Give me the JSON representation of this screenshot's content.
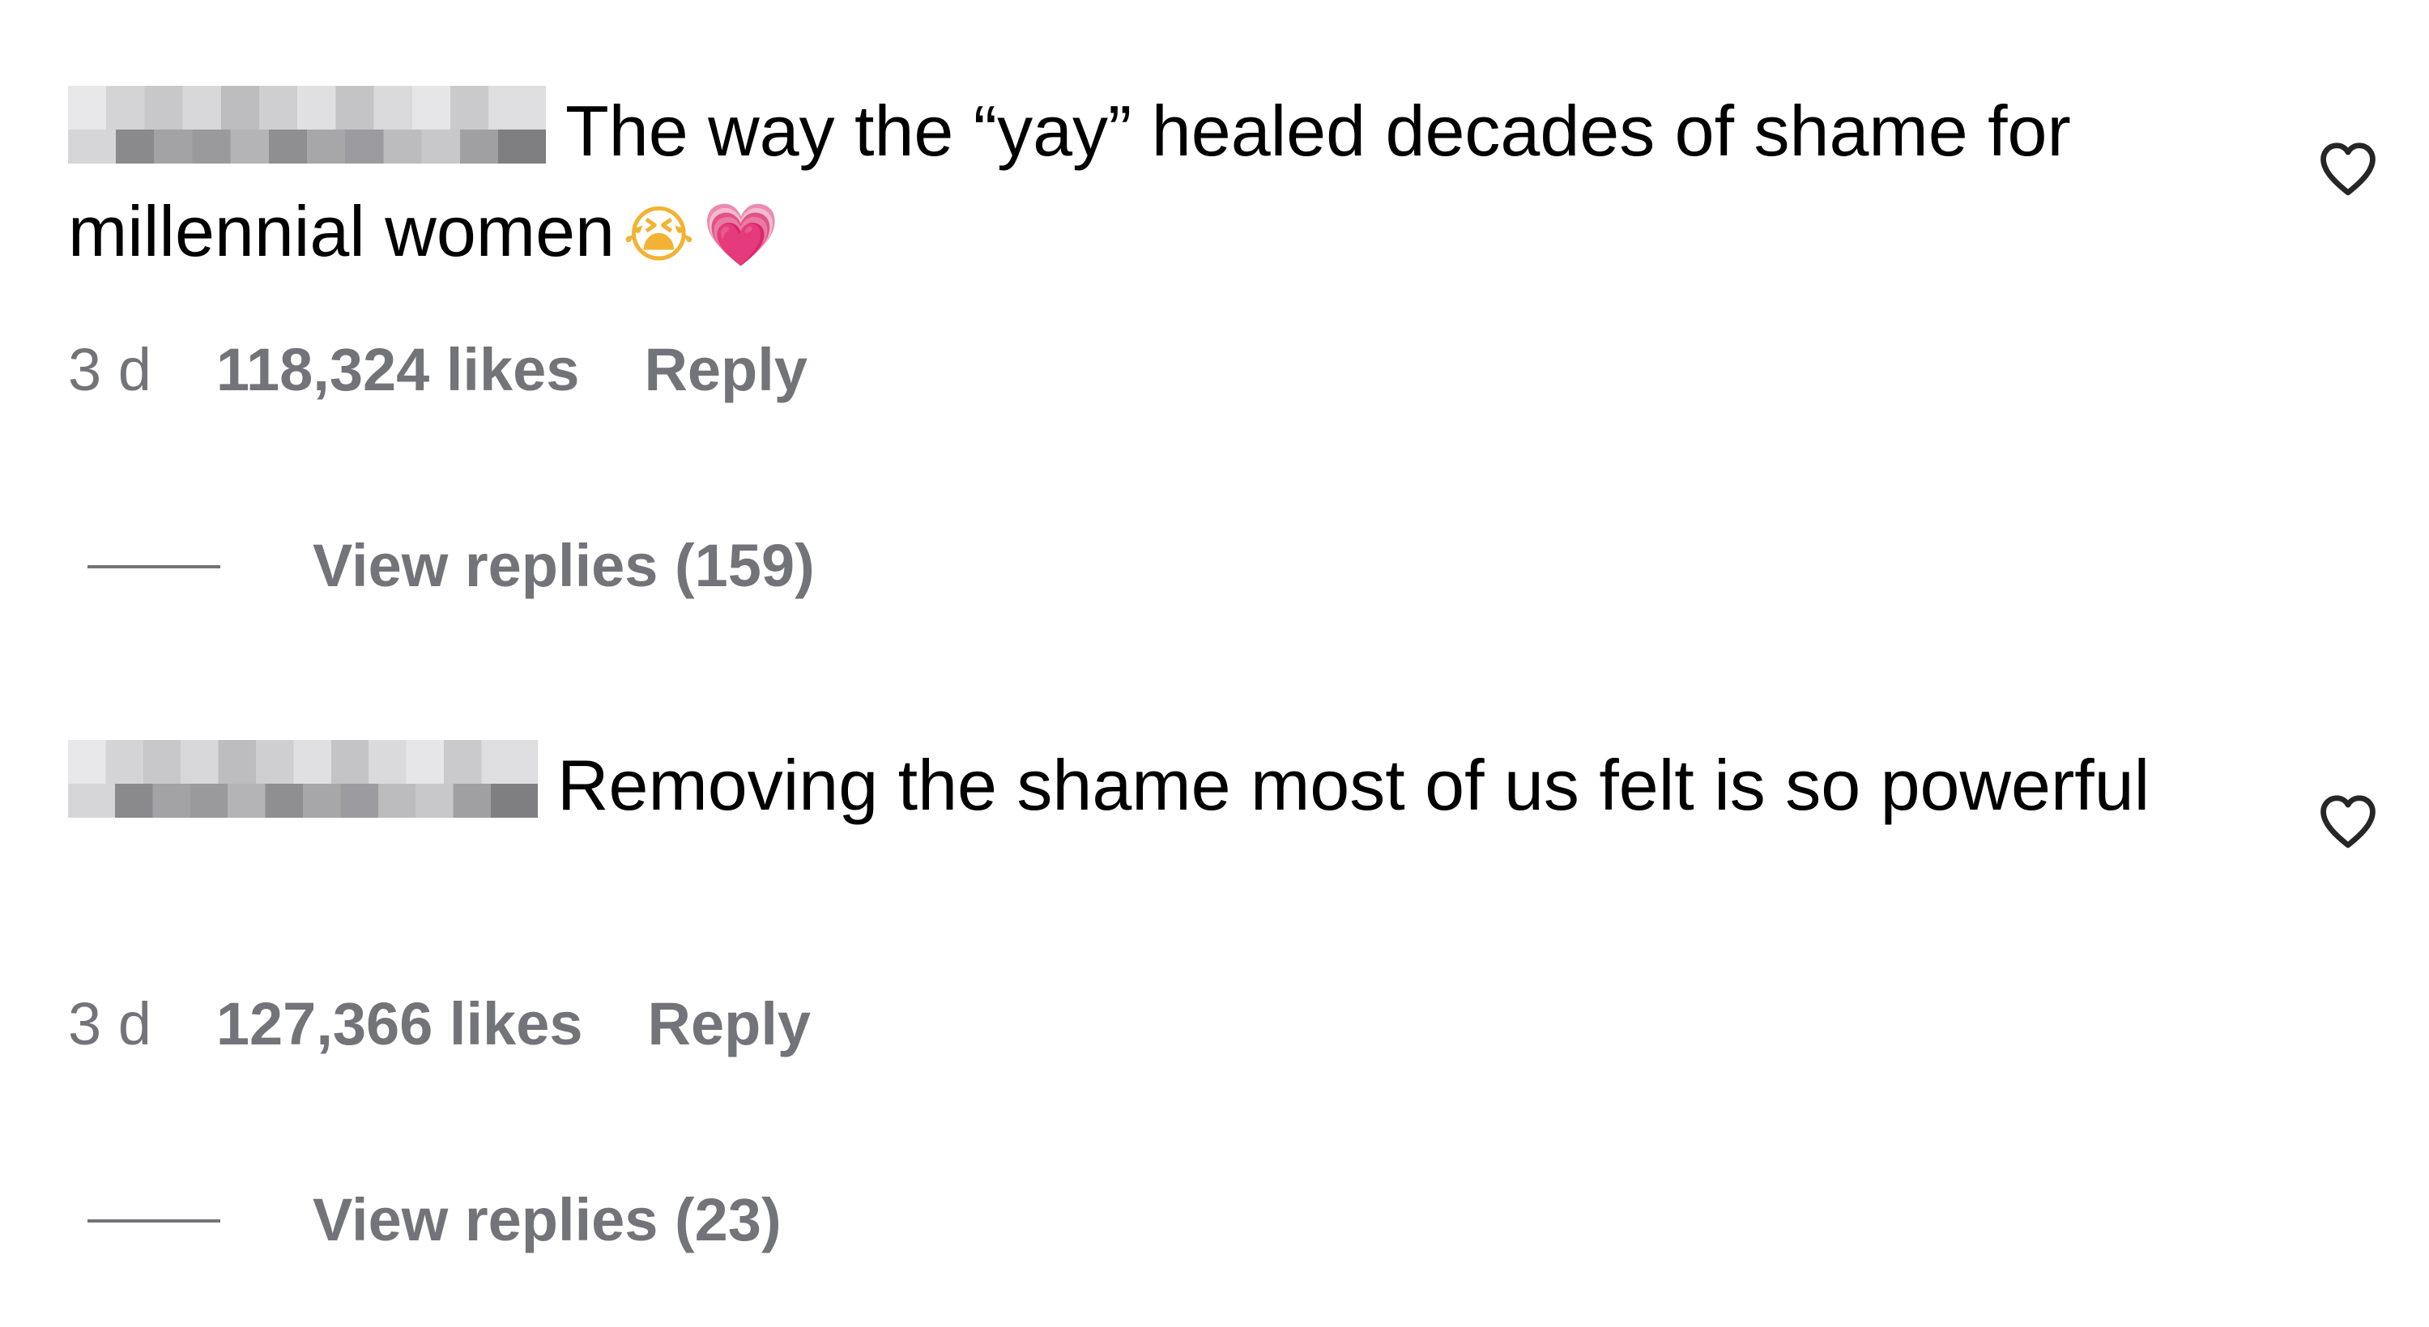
{
  "comments": [
    {
      "text": "The way the “yay” healed decades of shame for millennial women",
      "emojis": [
        "😭",
        "💗"
      ],
      "time": "3 d",
      "likes": "118,324 likes",
      "reply_label": "Reply",
      "view_replies_label": "View replies (159)",
      "like_icon": "heart-outline-icon"
    },
    {
      "text": "Removing the shame most of us felt is so powerful",
      "emojis": [],
      "time": "3 d",
      "likes": "127,366 likes",
      "reply_label": "Reply",
      "view_replies_label": "View replies (23)",
      "like_icon": "heart-outline-icon"
    }
  ],
  "colors": {
    "text": "#000000",
    "secondary": "#737479",
    "background": "#ffffff"
  }
}
